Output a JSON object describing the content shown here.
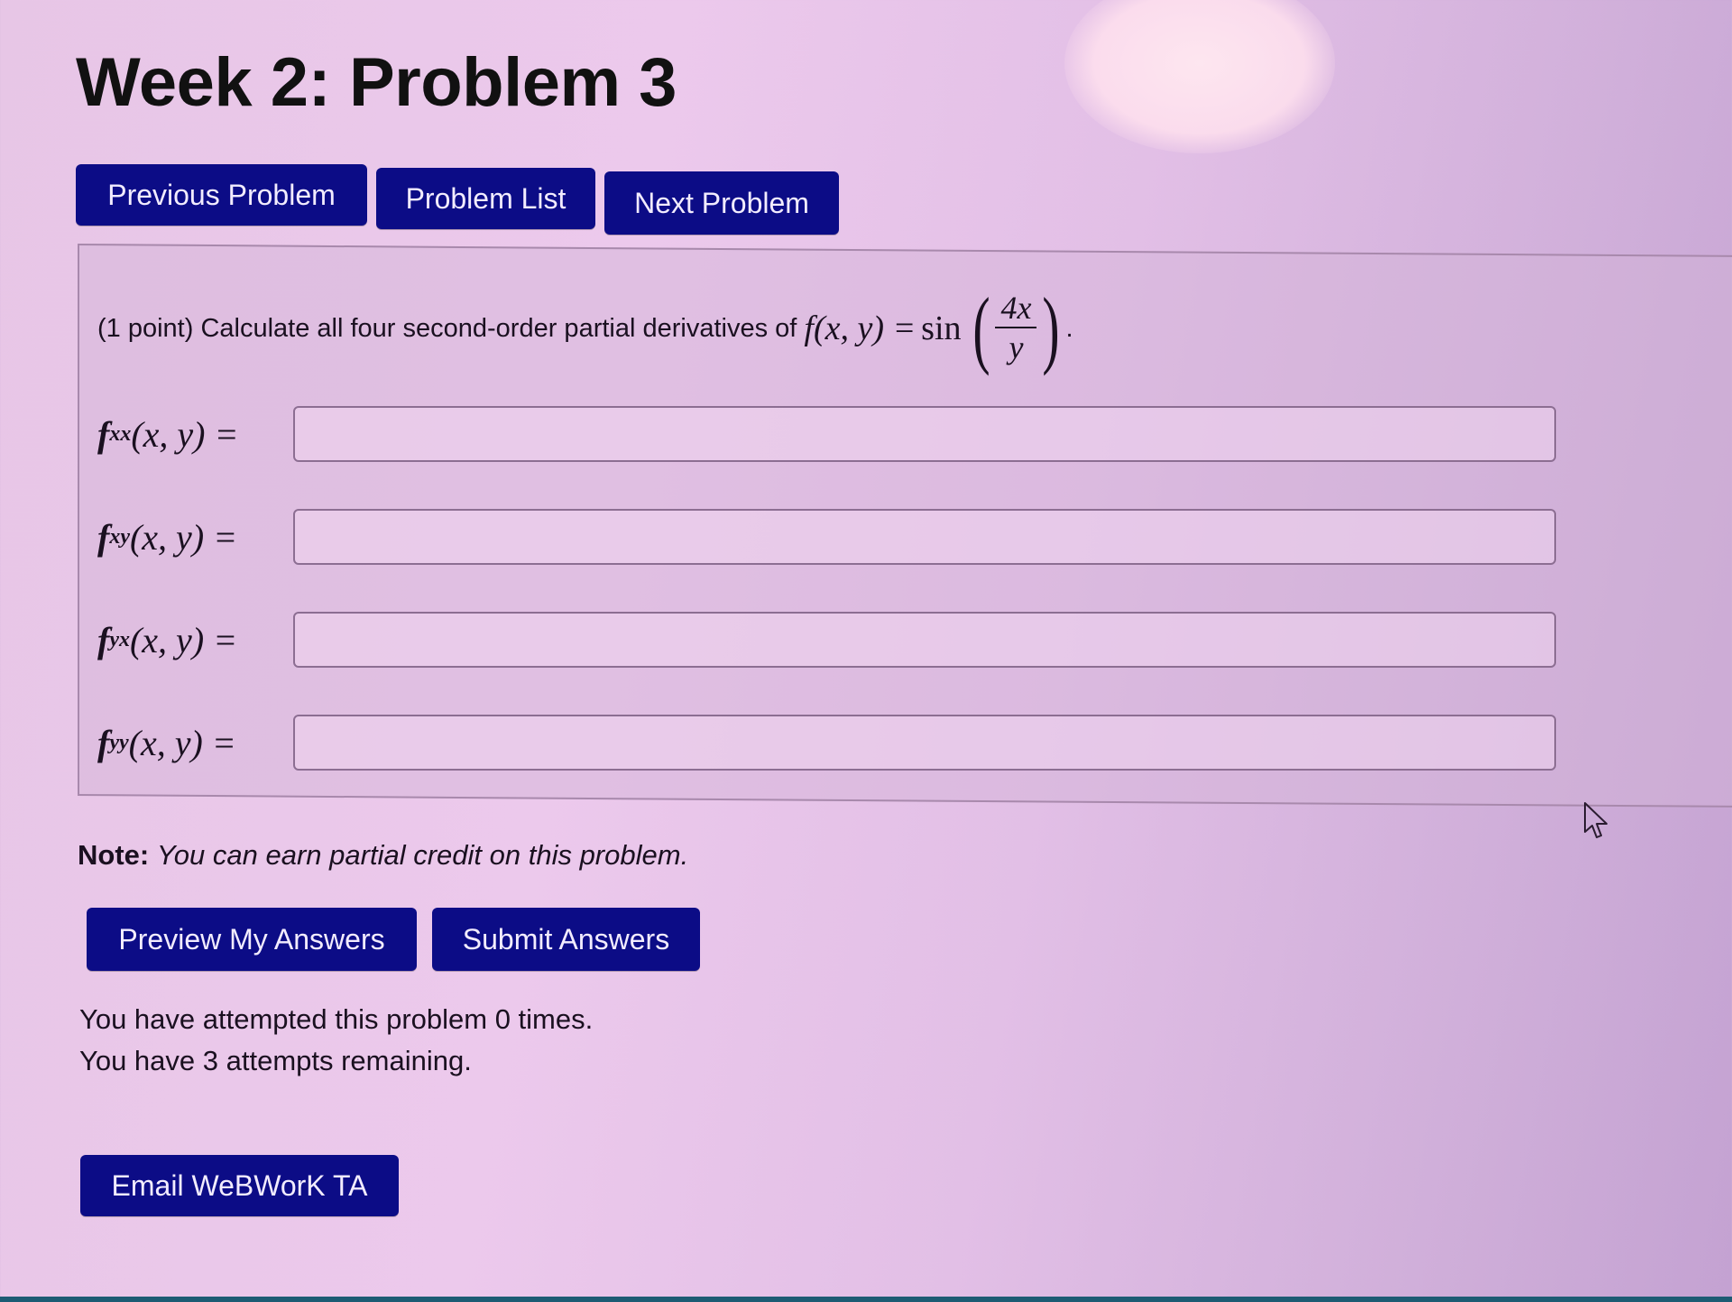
{
  "page": {
    "title": "Week 2: Problem 3"
  },
  "nav": {
    "previous_label": "Previous Problem",
    "list_label": "Problem List",
    "next_label": "Next Problem"
  },
  "problem": {
    "points": "(1 point)",
    "statement": "Calculate all four second-order partial derivatives of",
    "function_lhs": "f(x, y) = ",
    "function_name": "sin",
    "fraction_numerator": "4x",
    "fraction_denominator": "y",
    "trailing": ".",
    "answers": [
      {
        "sub": "xx",
        "label_f": "f",
        "args": " (x, y) =",
        "value": ""
      },
      {
        "sub": "xy",
        "label_f": "f",
        "args": " (x, y) =",
        "value": ""
      },
      {
        "sub": "yx",
        "label_f": "f",
        "args": " (x, y) =",
        "value": ""
      },
      {
        "sub": "yy",
        "label_f": "f",
        "args": " (x, y) =",
        "value": ""
      }
    ]
  },
  "note": {
    "label": "Note:",
    "text": "You can earn partial credit on this problem."
  },
  "actions": {
    "preview_label": "Preview My Answers",
    "submit_label": "Submit Answers",
    "email_label": "Email WeBWorK TA"
  },
  "status": {
    "attempted": "You have attempted this problem 0 times.",
    "remaining": "You have 3 attempts remaining."
  },
  "colors": {
    "button_bg": "#0c0c86",
    "button_text": "#f2ecff"
  }
}
